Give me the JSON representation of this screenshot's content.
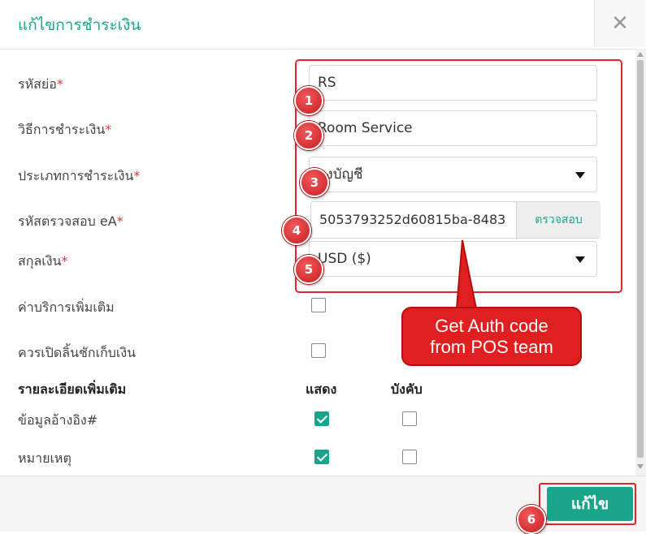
{
  "header": {
    "title": "แก้ไขการชำระเงิน",
    "close_glyph": "✕"
  },
  "form": {
    "short_code": {
      "label": "รหัสย่อ",
      "required_mark": "*",
      "value": "RS"
    },
    "method": {
      "label": "วิธีการชำระเงิน",
      "required_mark": "*",
      "value": "Room Service"
    },
    "type": {
      "label": "ประเภทการชำระเงิน",
      "required_mark": "*",
      "value": "ลงบัญชี"
    },
    "auth_code": {
      "label": "รหัสตรวจสอบ eA",
      "required_mark": "*",
      "value": "5053793252d60815ba-8483",
      "button_label": "ตรวจสอบ"
    },
    "currency": {
      "label": "สกุลเงิน",
      "required_mark": "*",
      "value": "USD ($)"
    },
    "extra_service": {
      "label": "ค่าบริการเพิ่มเติม",
      "checked": false
    },
    "open_drawer": {
      "label": "ควรเปิดลิ้นชักเก็บเงิน",
      "checked": false
    }
  },
  "details": {
    "heading": "รายละเอียดเพิ่มเติม",
    "col_show": "แสดง",
    "col_required": "บังคับ",
    "rows": [
      {
        "label": "ข้อมูลอ้างอิง#",
        "show": true,
        "required": false
      },
      {
        "label": "หมายเหตุ",
        "show": true,
        "required": false
      }
    ]
  },
  "annotations": {
    "badges": [
      "1",
      "2",
      "3",
      "4",
      "5",
      "6"
    ],
    "callout_line1": "Get Auth code",
    "callout_line2": "from POS team",
    "highlight_color": "#e3262b"
  },
  "footer": {
    "save_label": "แก้ไข"
  },
  "colors": {
    "accent": "#1aa58a",
    "required": "#e03a3a",
    "annotation": "#e02020"
  }
}
